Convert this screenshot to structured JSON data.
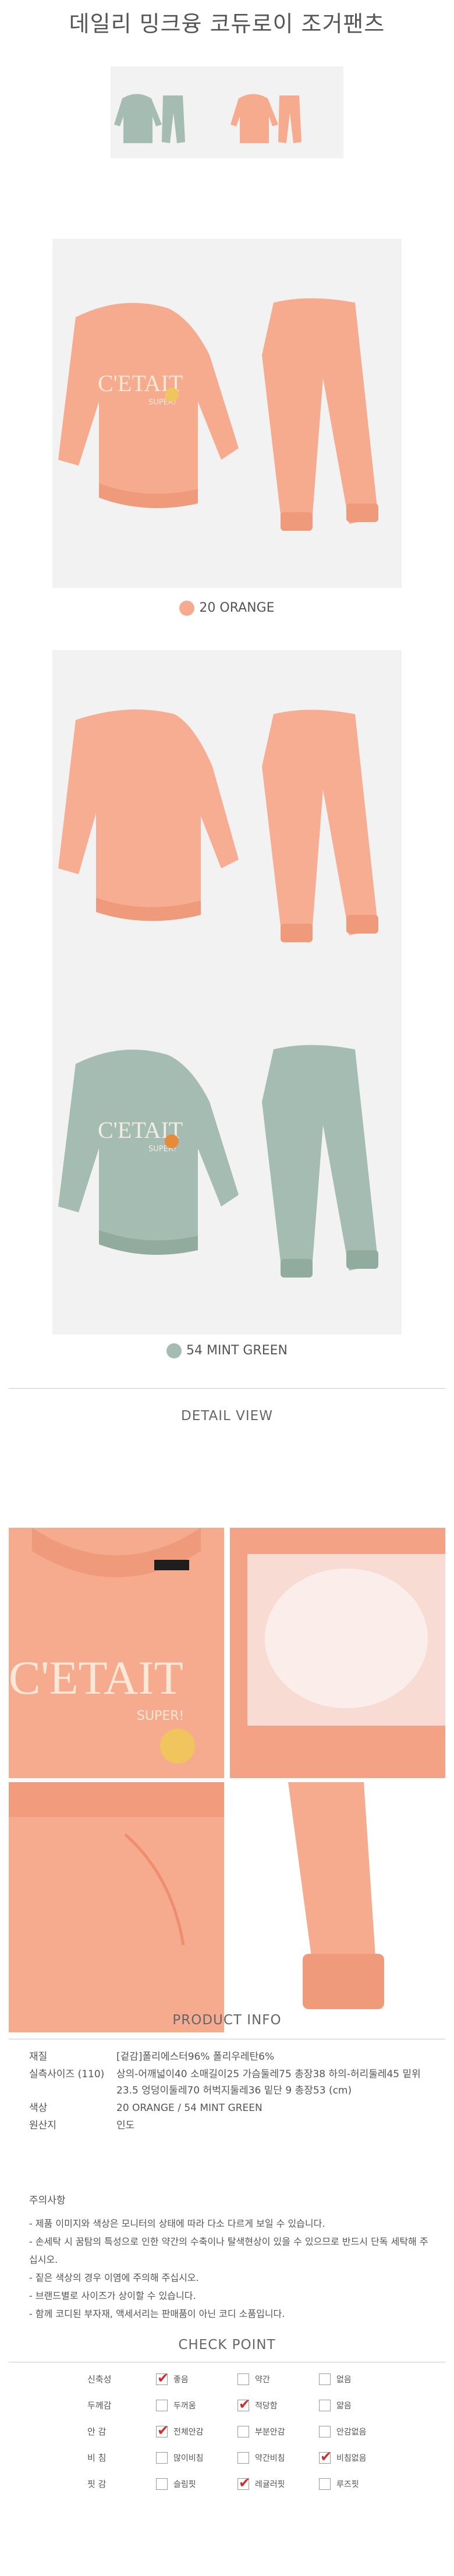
{
  "title": "데일리 밍크융 코듀로이 조거팬츠",
  "colors": {
    "orange": "#f6ab8f",
    "mint": "#a4bcb2"
  },
  "swatches": [
    {
      "label": "20 ORANGE"
    },
    {
      "label": "54 MINT GREEN"
    }
  ],
  "sections": {
    "detail_view": "DETAIL VIEW",
    "product_info": "PRODUCT INFO",
    "check_point": "CHECK POINT"
  },
  "garment": {
    "print_text": "C'ETAIT",
    "print_sub": "SUPER!"
  },
  "product_info": [
    {
      "label": "재질",
      "value": "[겉감]폴리에스터96% 폴리우레탄6%"
    },
    {
      "label": "실측사이즈 (110)",
      "value": "상의-어깨넓이40 소매길이25 가슴둘레75 총장38 하의-허리둘레45 밑위23.5 엉덩이둘레70 허벅지둘레36 밑단 9 총장53 (cm)"
    },
    {
      "label": "색상",
      "value": "20 ORANGE / 54 MINT GREEN"
    },
    {
      "label": "원산지",
      "value": "인도"
    }
  ],
  "notes": {
    "title": "주의사항",
    "items": [
      "- 제품 이미지와 색상은 모니터의 상태에 따라 다소 다르게 보일 수 있습니다.",
      "- 손세탁 시 꿈탐의 특성으로 인한 약간의 수축이나 탈색현상이 있을 수 있으므로 반드시 단독 세탁해 주십시오.",
      "- 짙은 색상의 경우 이염에 주의해 주십시오.",
      "- 브랜드별로 사이즈가 상이할 수 있습니다.",
      "- 함께 코디된 부자재, 액세서리는 판매품이 아닌 코디 소품입니다."
    ]
  },
  "check_point": [
    {
      "label": "신축성",
      "options": [
        {
          "text": "좋음",
          "checked": true
        },
        {
          "text": "약간",
          "checked": false
        },
        {
          "text": "없음",
          "checked": false
        }
      ]
    },
    {
      "label": "두께감",
      "options": [
        {
          "text": "두꺼움",
          "checked": false
        },
        {
          "text": "적당함",
          "checked": true
        },
        {
          "text": "얇음",
          "checked": false
        }
      ]
    },
    {
      "label": "안 감",
      "options": [
        {
          "text": "전체안감",
          "checked": true
        },
        {
          "text": "부분안감",
          "checked": false
        },
        {
          "text": "안감없음",
          "checked": false
        }
      ]
    },
    {
      "label": "비 침",
      "options": [
        {
          "text": "많이비침",
          "checked": false
        },
        {
          "text": "약간비침",
          "checked": false
        },
        {
          "text": "비침없음",
          "checked": true
        }
      ]
    },
    {
      "label": "핏 감",
      "options": [
        {
          "text": "슬림핏",
          "checked": false
        },
        {
          "text": "레귤러핏",
          "checked": true
        },
        {
          "text": "루즈핏",
          "checked": false
        }
      ]
    }
  ]
}
